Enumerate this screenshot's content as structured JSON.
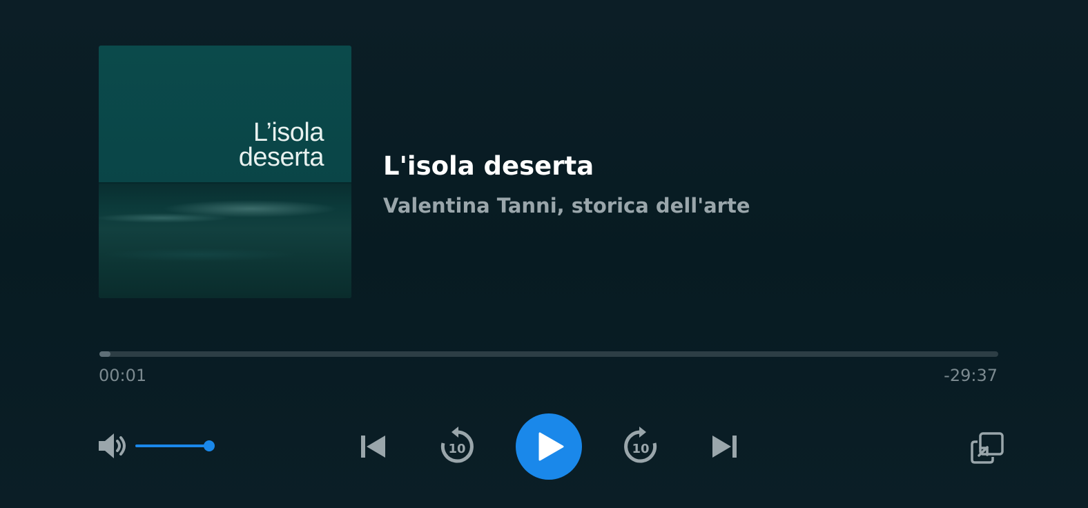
{
  "episode": {
    "cover_text": "L’isola\ndeserta",
    "title": "L'isola deserta",
    "author": "Valentina Tanni, storica dell'arte"
  },
  "progress": {
    "elapsed": "00:01",
    "remaining": "-29:37",
    "fraction": 0.01
  },
  "volume": {
    "level": 1.0
  },
  "controls": {
    "volume_icon": "volume-icon",
    "previous_icon": "skip-previous-icon",
    "rewind_icon": "rewind-10-icon",
    "rewind_seconds": "10",
    "play_icon": "play-icon",
    "forward_icon": "forward-10-icon",
    "forward_seconds": "10",
    "next_icon": "skip-next-icon",
    "popout_icon": "popout-icon"
  },
  "colors": {
    "accent": "#1a88ea",
    "background": "#0a1d24",
    "icon_gray": "#9aa6ab"
  }
}
